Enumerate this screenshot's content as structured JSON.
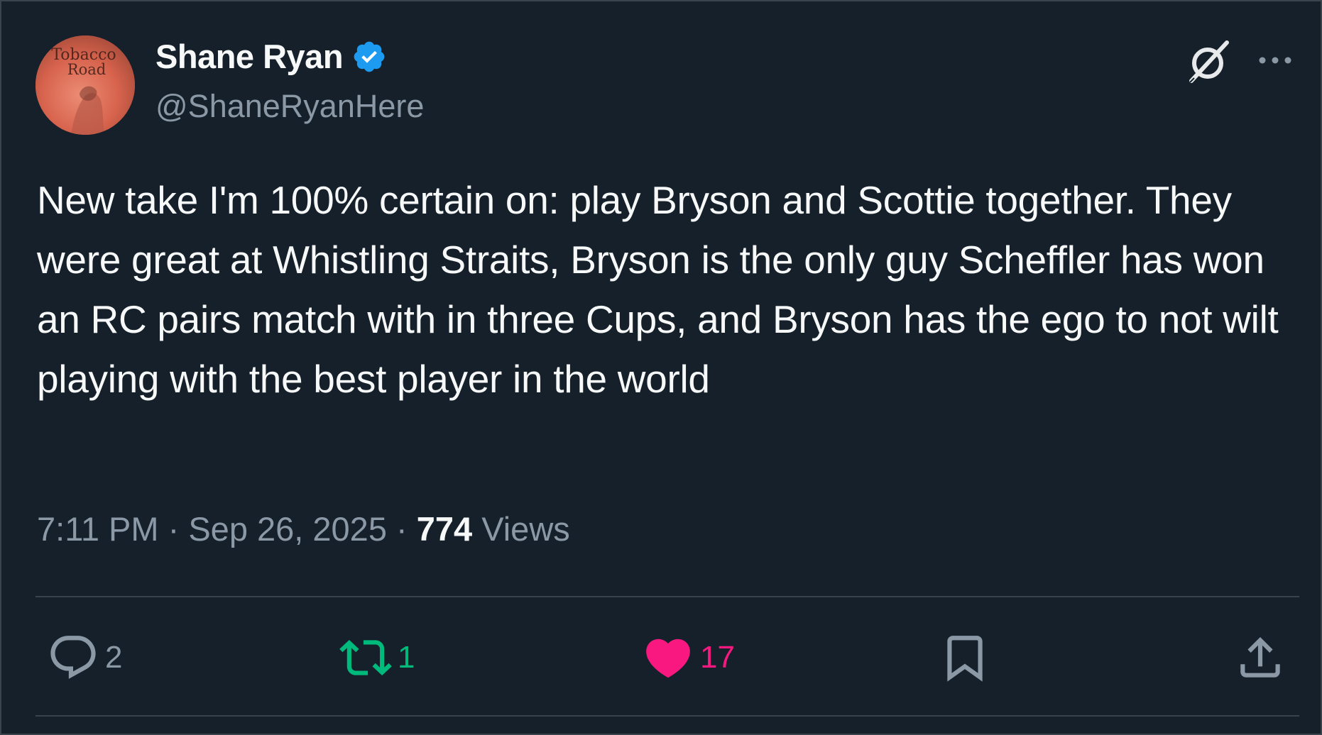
{
  "author": {
    "display_name": "Shane Ryan",
    "handle": "@ShaneRyanHere",
    "verified": true,
    "avatar_text_line1": "Tobacco",
    "avatar_text_line2": "Road"
  },
  "tweet": {
    "text": "New take I'm 100% certain on: play Bryson and Scottie together. They were great at Whistling Straits, Bryson is the only guy Scheffler has won an RC pairs match with in three Cups, and Bryson has the ego to not wilt playing with the best player in the world"
  },
  "meta": {
    "time": "7:11 PM",
    "separator": "·",
    "date": "Sep 26, 2025",
    "views_count": "774",
    "views_label": "Views"
  },
  "actions": {
    "reply_count": "2",
    "retweet_count": "1",
    "like_count": "17"
  },
  "icons": {
    "verified": "verified-badge-icon",
    "grok": "grok-icon",
    "more": "more-options-icon",
    "reply": "reply-icon",
    "retweet": "retweet-icon",
    "like": "heart-icon",
    "bookmark": "bookmark-icon",
    "share": "share-icon"
  },
  "colors": {
    "background": "#15202b",
    "text_primary": "#f7f9f9",
    "text_secondary": "#8b98a5",
    "verified_blue": "#1d9bf0",
    "retweet_green": "#00ba7c",
    "like_pink": "#f91880",
    "divider": "#38444d"
  }
}
